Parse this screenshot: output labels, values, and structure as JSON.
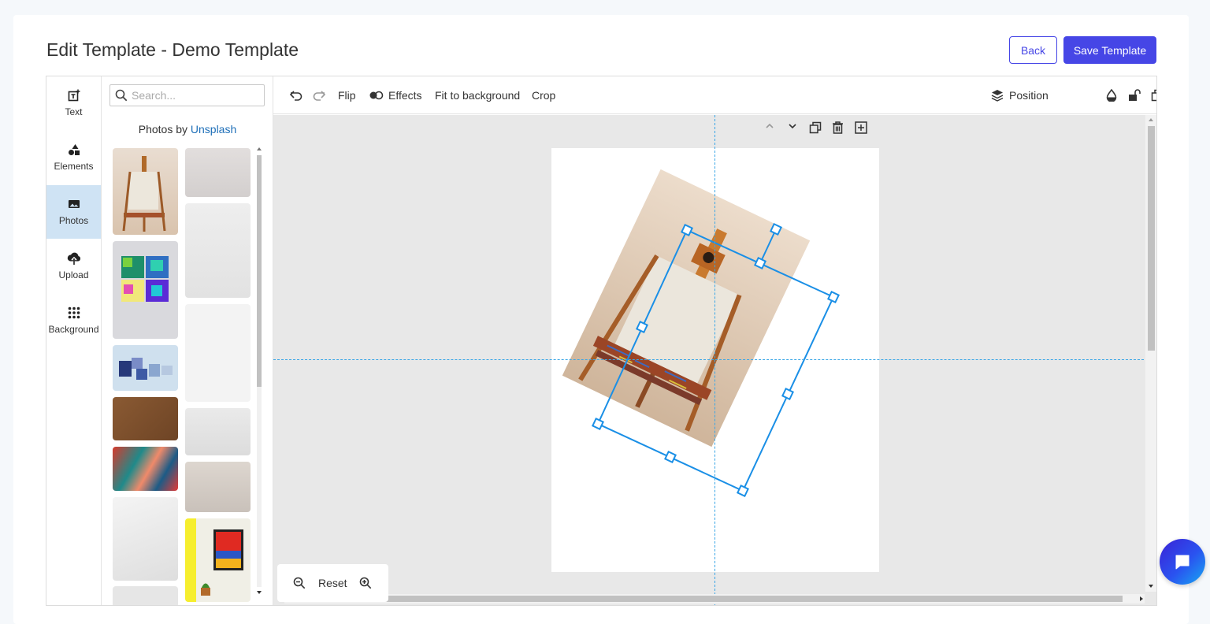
{
  "header": {
    "title": "Edit Template - Demo Template",
    "back_label": "Back",
    "save_label": "Save Template"
  },
  "rail": [
    {
      "label": "Text",
      "icon": "text-icon"
    },
    {
      "label": "Elements",
      "icon": "shapes-icon"
    },
    {
      "label": "Photos",
      "icon": "photo-icon",
      "active": true
    },
    {
      "label": "Upload",
      "icon": "upload-icon"
    },
    {
      "label": "Background",
      "icon": "grid-dots-icon"
    }
  ],
  "panel": {
    "search_placeholder": "Search...",
    "credit_prefix": "Photos by",
    "credit_link": "Unsplash"
  },
  "toolbar": {
    "flip": "Flip",
    "effects": "Effects",
    "fit": "Fit to background",
    "crop": "Crop",
    "position": "Position"
  },
  "zoom": {
    "reset": "Reset"
  },
  "colors": {
    "accent": "#4646e6",
    "selection": "#1a8fe6",
    "guide": "#3aa6e6"
  }
}
